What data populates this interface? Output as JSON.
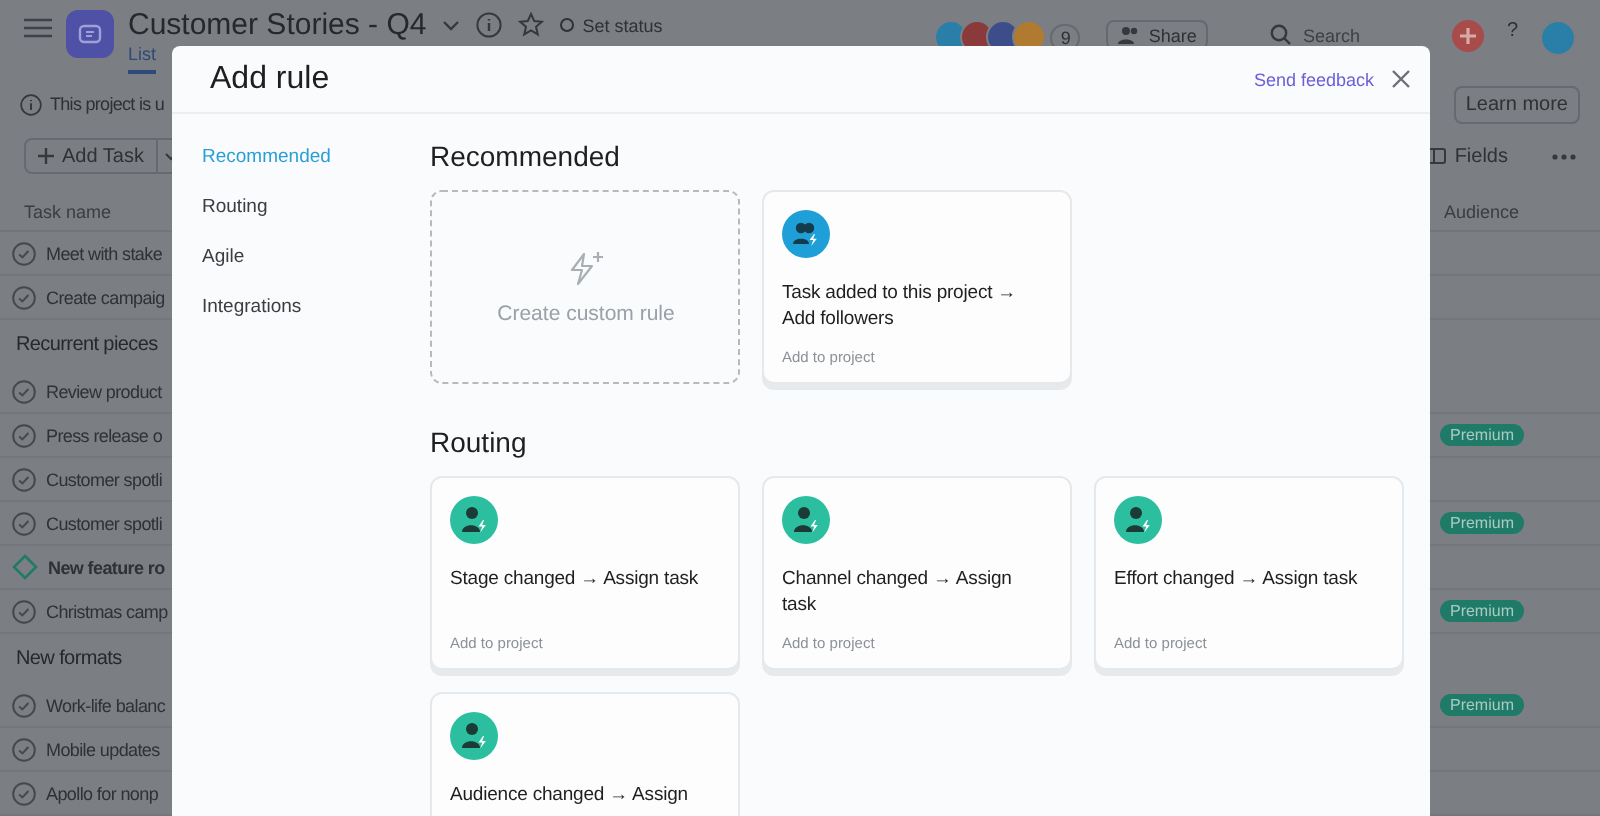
{
  "app": {
    "title": "Customer Stories - Q4",
    "set_status": "Set status",
    "tabs": [
      {
        "label": "List",
        "selected": true
      }
    ],
    "member_count": "9",
    "share": "Share",
    "search": {
      "placeholder": "Search"
    },
    "help": "?",
    "banner": "This project is u",
    "learn_more": "Learn more",
    "add_task": "Add Task",
    "fields": "Fields",
    "columns": [
      "Task name",
      "Audience"
    ],
    "rows": [
      {
        "kind": "task",
        "name": "Meet with stake"
      },
      {
        "kind": "task",
        "name": "Create campaig"
      },
      {
        "kind": "section",
        "name": "Recurrent pieces"
      },
      {
        "kind": "task",
        "name": "Review product"
      },
      {
        "kind": "task",
        "name": "Press release o",
        "audience": "Premium"
      },
      {
        "kind": "task",
        "name": "Customer spotli"
      },
      {
        "kind": "task",
        "name": "Customer spotli",
        "audience": "Premium"
      },
      {
        "kind": "milestone",
        "name": "New feature ro"
      },
      {
        "kind": "task",
        "name": "Christmas camp",
        "audience": "Premium"
      },
      {
        "kind": "section",
        "name": "New formats"
      },
      {
        "kind": "task",
        "name": "Work-life balanc",
        "audience": "Premium"
      },
      {
        "kind": "task",
        "name": "Mobile updates"
      },
      {
        "kind": "task",
        "name": "Apollo for nonp"
      }
    ]
  },
  "modal": {
    "title": "Add rule",
    "send_feedback": "Send feedback",
    "nav": [
      {
        "label": "Recommended",
        "selected": true
      },
      {
        "label": "Routing",
        "selected": false
      },
      {
        "label": "Agile",
        "selected": false
      },
      {
        "label": "Integrations",
        "selected": false
      }
    ],
    "sections": [
      {
        "title": "Recommended",
        "cards": [
          {
            "kind": "custom",
            "title": "Create custom rule"
          },
          {
            "kind": "followers",
            "color": "#1e9fd8",
            "title": "Task added to this project → Add followers",
            "action": "Add to project"
          }
        ]
      },
      {
        "title": "Routing",
        "cards": [
          {
            "kind": "assign",
            "color": "#2bbf9f",
            "title": "Stage changed → Assign task",
            "action": "Add to project"
          },
          {
            "kind": "assign",
            "color": "#2bbf9f",
            "title": "Channel changed → Assign task",
            "action": "Add to project"
          },
          {
            "kind": "assign",
            "color": "#2bbf9f",
            "title": "Effort changed → Assign task",
            "action": "Add to project"
          },
          {
            "kind": "assign",
            "color": "#2bbf9f",
            "title": "Audience changed → Assign"
          }
        ]
      }
    ]
  }
}
